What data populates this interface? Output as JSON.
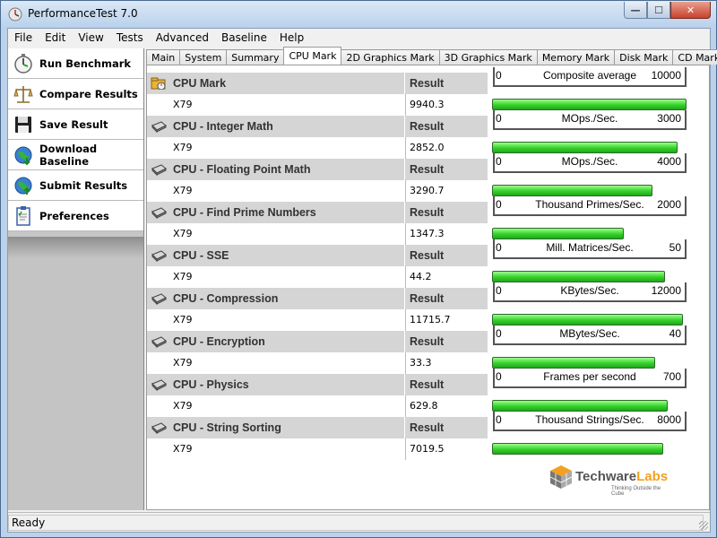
{
  "window": {
    "title": "PerformanceTest 7.0",
    "min_glyph": "—",
    "max_glyph": "☐",
    "close_glyph": "✕"
  },
  "menu": [
    "File",
    "Edit",
    "View",
    "Tests",
    "Advanced",
    "Baseline",
    "Help"
  ],
  "sidebar": {
    "items": [
      {
        "label": "Run Benchmark",
        "icon": "stopwatch-icon"
      },
      {
        "label": "Compare Results",
        "icon": "scales-icon"
      },
      {
        "label": "Save Result",
        "icon": "floppy-disk-icon"
      },
      {
        "label": "Download Baseline",
        "icon": "globe-download-icon"
      },
      {
        "label": "Submit Results",
        "icon": "globe-upload-icon"
      },
      {
        "label": "Preferences",
        "icon": "clipboard-icon"
      }
    ]
  },
  "tabs": [
    "Main",
    "System",
    "Summary",
    "CPU Mark",
    "2D Graphics Mark",
    "3D Graphics Mark",
    "Memory Mark",
    "Disk Mark",
    "CD Mark"
  ],
  "active_tab": "CPU Mark",
  "result_header": "Result",
  "tests": [
    {
      "name": "CPU Mark",
      "machine": "X79",
      "value": "9940.3",
      "min": "0",
      "unit": "Composite average",
      "max": "10000",
      "fill": 0.994
    },
    {
      "name": "CPU - Integer Math",
      "machine": "X79",
      "value": "2852.0",
      "min": "0",
      "unit": "MOps./Sec.",
      "max": "3000",
      "fill": 0.951
    },
    {
      "name": "CPU - Floating Point Math",
      "machine": "X79",
      "value": "3290.7",
      "min": "0",
      "unit": "MOps./Sec.",
      "max": "4000",
      "fill": 0.823
    },
    {
      "name": "CPU - Find Prime Numbers",
      "machine": "X79",
      "value": "1347.3",
      "min": "0",
      "unit": "Thousand Primes/Sec.",
      "max": "2000",
      "fill": 0.674
    },
    {
      "name": "CPU - SSE",
      "machine": "X79",
      "value": "44.2",
      "min": "0",
      "unit": "Mill. Matrices/Sec.",
      "max": "50",
      "fill": 0.884
    },
    {
      "name": "CPU - Compression",
      "machine": "X79",
      "value": "11715.7",
      "min": "0",
      "unit": "KBytes/Sec.",
      "max": "12000",
      "fill": 0.976
    },
    {
      "name": "CPU - Encryption",
      "machine": "X79",
      "value": "33.3",
      "min": "0",
      "unit": "MBytes/Sec.",
      "max": "40",
      "fill": 0.833
    },
    {
      "name": "CPU - Physics",
      "machine": "X79",
      "value": "629.8",
      "min": "0",
      "unit": "Frames per second",
      "max": "700",
      "fill": 0.9
    },
    {
      "name": "CPU - String Sorting",
      "machine": "X79",
      "value": "7019.5",
      "min": "0",
      "unit": "Thousand Strings/Sec.",
      "max": "8000",
      "fill": 0.877
    }
  ],
  "logo": {
    "brand_a": "Techware",
    "brand_b": "Labs",
    "tagline": "Thinking Outside the Cube"
  },
  "status": "Ready",
  "colors": {
    "bar": "#35d12a",
    "header_row": "#d5d5d5",
    "title_bar": "#b9d1ec",
    "close_button": "#c8412c"
  }
}
